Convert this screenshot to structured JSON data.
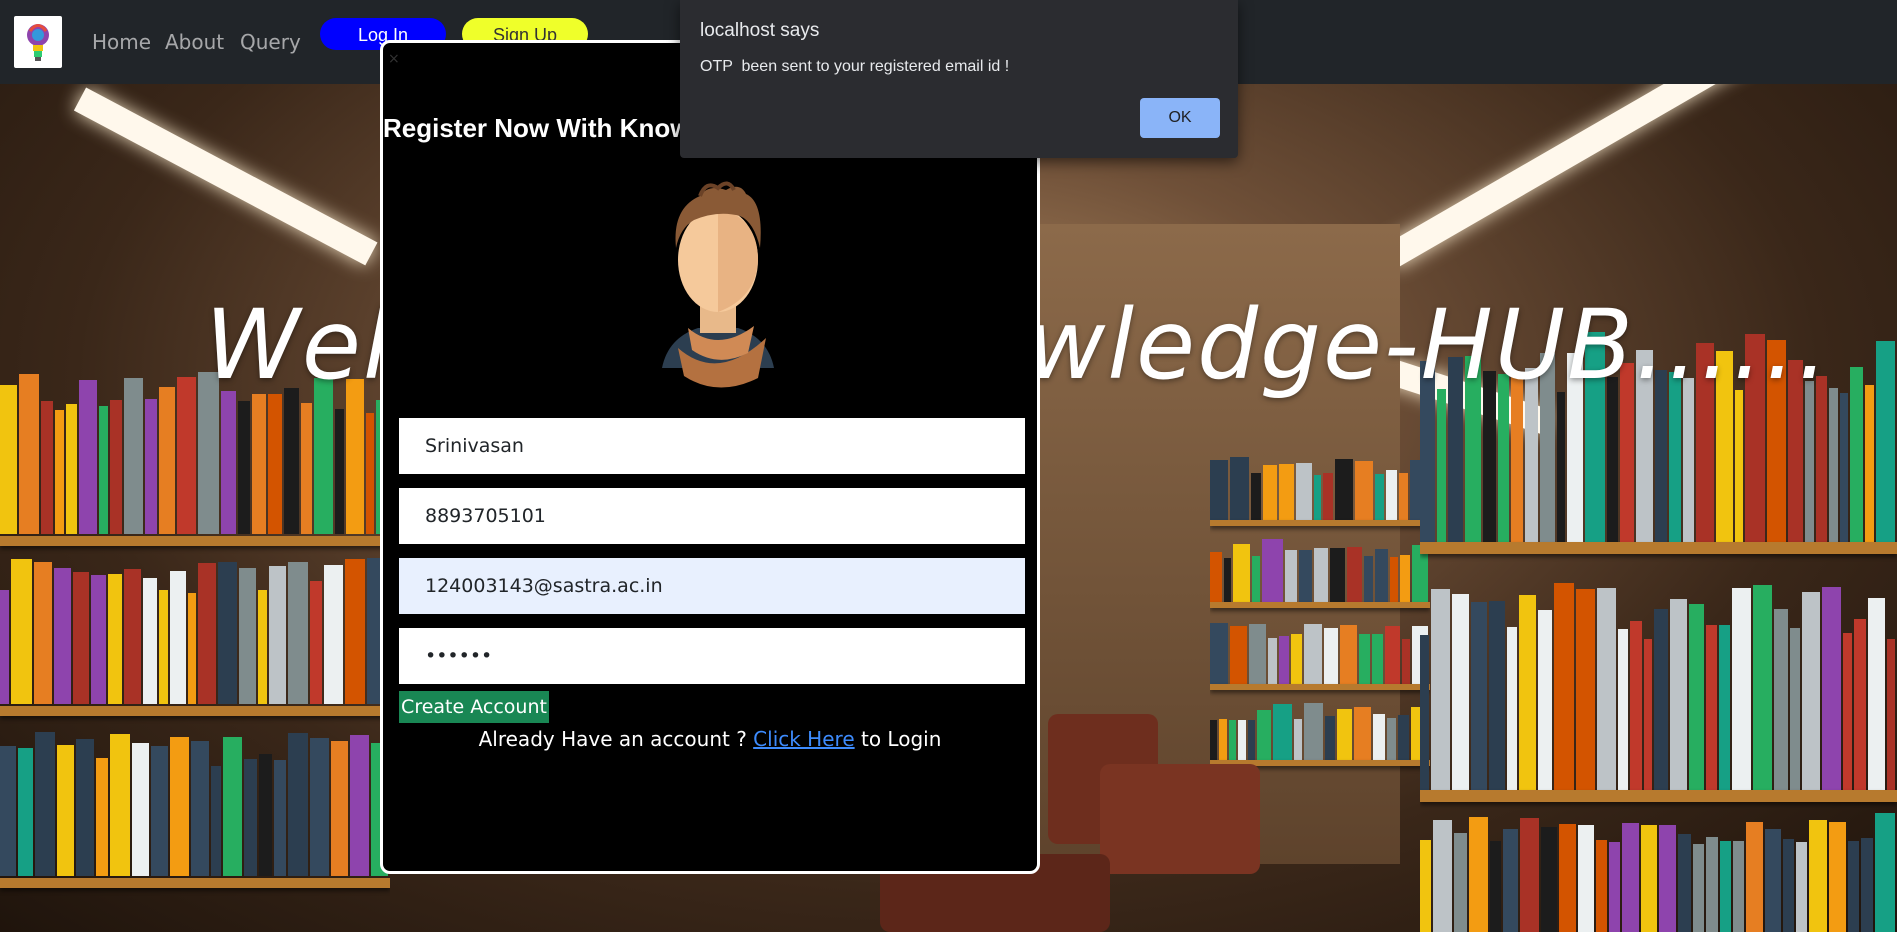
{
  "navbar": {
    "links": [
      "Home",
      "About",
      "Query"
    ],
    "login_label": "Log In",
    "signup_label": "Sign Up"
  },
  "hero": {
    "welcome_text": "Welcome To Knowledge-HUB......"
  },
  "register_modal": {
    "close_label": "×",
    "title": "Register Now With Knowledge-HUB",
    "name_value": "Srinivasan",
    "phone_value": "8893705101",
    "email_value": "124003143@sastra.ac.in",
    "password_value": "••••••",
    "create_account_label": "Create Account",
    "already_text": "Already Have an account ?",
    "click_here_label": "Click Here",
    "to_login_text": "to Login"
  },
  "alert": {
    "title": "localhost says",
    "message": "OTP  been sent to your registered email id !",
    "ok_label": "OK"
  },
  "colors": {
    "navbar_bg": "#212529",
    "login_btn": "#0000ff",
    "signup_btn": "#efff2a",
    "create_btn": "#198754",
    "alert_ok": "#8ab4f8"
  }
}
